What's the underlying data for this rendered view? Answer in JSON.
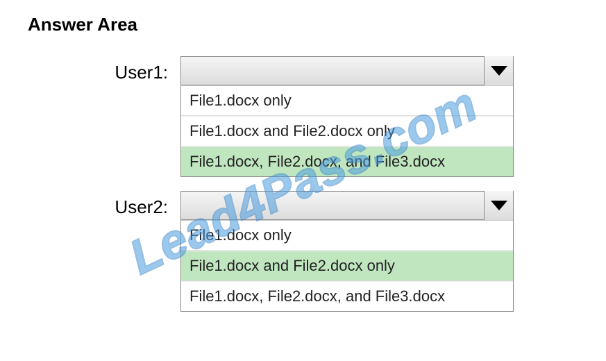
{
  "title": "Answer Area",
  "watermark": "Lead4Pass.com",
  "fields": [
    {
      "label": "User1:",
      "options": [
        {
          "text": "File1.docx only",
          "highlighted": false
        },
        {
          "text": "File1.docx and File2.docx only",
          "highlighted": false
        },
        {
          "text": "File1.docx, File2.docx, and File3.docx",
          "highlighted": true
        }
      ]
    },
    {
      "label": "User2:",
      "options": [
        {
          "text": "File1.docx only",
          "highlighted": false
        },
        {
          "text": "File1.docx and File2.docx only",
          "highlighted": true
        },
        {
          "text": "File1.docx, File2.docx, and File3.docx",
          "highlighted": false
        }
      ]
    }
  ]
}
